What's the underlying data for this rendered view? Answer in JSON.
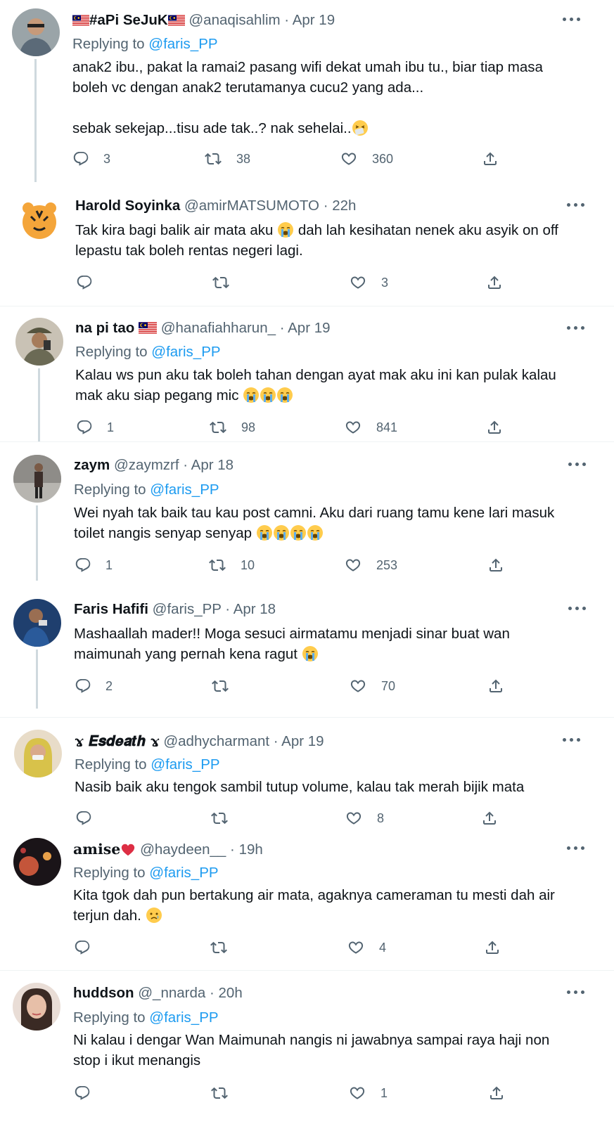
{
  "icons": {
    "reply": "reply-icon",
    "retweet": "retweet-icon",
    "like": "heart-icon",
    "share": "share-icon",
    "more": "more-icon"
  },
  "colors": {
    "link": "#1d9bf0",
    "secondary": "#536471",
    "text": "#0f1419",
    "thread_line": "#cfd9de"
  },
  "tweets": [
    {
      "name": "#aPi SeJuK",
      "handle": "@anaqisahlim",
      "dot": "·",
      "date": "Apr 19",
      "replying_prefix": "Replying to",
      "replying_to": "@faris_PP",
      "body": [
        "anak2 ibu., pakat la ramai2 pasang wifi dekat umah ibu tu., biar tiap masa",
        "boleh vc dengan anak2 terutamanya cucu2 yang ada...",
        "",
        "sebak sekejap...tisu ade tak..? nak sehelai.."
      ],
      "replies": "3",
      "retweets": "38",
      "likes": "360"
    },
    {
      "name": "Harold Soyinka",
      "handle": "@amirMATSUMOTO",
      "dot": "·",
      "date": "22h",
      "body": [
        "Tak kira bagi balik air mata aku",
        "lepastu tak boleh rentas negeri lagi."
      ],
      "body_tail": "dah lah kesihatan nenek aku asyik on off",
      "replies": "",
      "retweets": "",
      "likes": "3"
    },
    {
      "name": "na pi tao",
      "handle": "@hanafiahharun_",
      "dot": "·",
      "date": "Apr 19",
      "replying_prefix": "Replying to",
      "replying_to": "@faris_PP",
      "body": [
        "Kalau ws pun aku tak boleh tahan dengan ayat mak aku ini kan pulak kalau",
        "mak aku siap pegang mic"
      ],
      "replies": "1",
      "retweets": "98",
      "likes": "841"
    },
    {
      "name": "zaym",
      "handle": "@zaymzrf",
      "dot": "·",
      "date": "Apr 18",
      "replying_prefix": "Replying to",
      "replying_to": "@faris_PP",
      "body": [
        "Wei nyah tak baik tau kau post camni. Aku dari ruang tamu kene lari masuk",
        "toilet nangis senyap senyap"
      ],
      "replies": "1",
      "retweets": "10",
      "likes": "253"
    },
    {
      "name": "Faris Hafifi",
      "handle": "@faris_PP",
      "dot": "·",
      "date": "Apr 18",
      "body": [
        "Mashaallah mader!! Moga sesuci airmatamu menjadi sinar buat wan",
        "maimunah yang pernah kena ragut"
      ],
      "replies": "2",
      "retweets": "",
      "likes": "70"
    },
    {
      "name": "ɤ 𝑬𝒔𝒅𝒆𝒂𝒕𝒉 ɤ",
      "handle": "@adhycharmant",
      "dot": "·",
      "date": "Apr 19",
      "replying_prefix": "Replying to",
      "replying_to": "@faris_PP",
      "body": [
        "Nasib baik aku tengok sambil tutup volume, kalau tak merah bijik mata"
      ],
      "replies": "",
      "retweets": "",
      "likes": "8"
    },
    {
      "name": "𝐚𝐦𝐢𝐬𝐞",
      "handle": "@haydeen__",
      "dot": "·",
      "date": "19h",
      "replying_prefix": "Replying to",
      "replying_to": "@faris_PP",
      "body": [
        "Kita tgok dah pun bertakung air mata, agaknya cameraman tu mesti dah air",
        "terjun dah."
      ],
      "replies": "",
      "retweets": "",
      "likes": "4"
    },
    {
      "name": "huddson",
      "handle": "@_nnarda",
      "dot": "·",
      "date": "20h",
      "replying_prefix": "Replying to",
      "replying_to": "@faris_PP",
      "body": [
        "Ni kalau i dengar Wan Maimunah nangis ni jawabnya sampai raya haji non",
        "stop i ikut menangis"
      ],
      "replies": "",
      "retweets": "",
      "likes": "1"
    }
  ]
}
